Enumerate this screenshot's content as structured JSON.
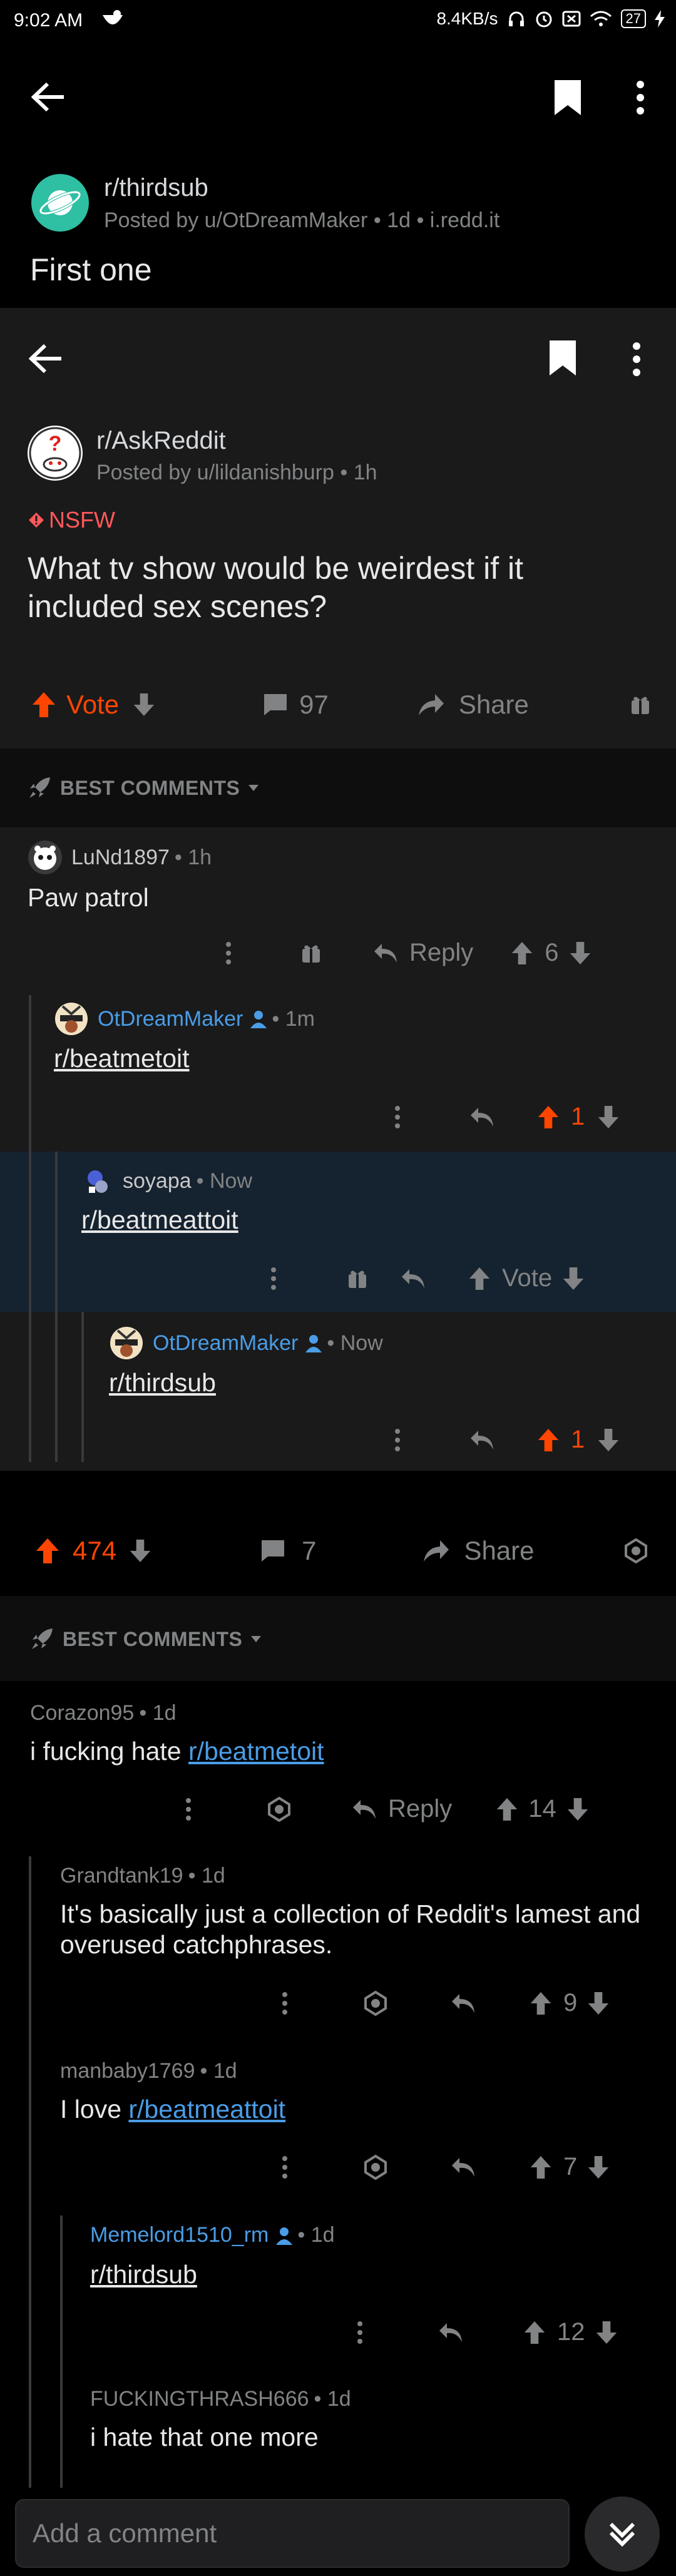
{
  "status_bar": {
    "time": "9:02 AM",
    "speed": "8.4KB/s",
    "battery": "27"
  },
  "outer_post": {
    "subreddit": "r/thirdsub",
    "byline": "Posted by u/OtDreamMaker • 1d • i.redd.it",
    "title": "First one"
  },
  "inner_post": {
    "subreddit": "r/AskReddit",
    "byline": "Posted by u/lildanishburp • 1h",
    "nsfw": "NSFW",
    "title_line1": "What tv show would be weirdest if it",
    "title_line2": "included sex scenes?",
    "vote": "Vote",
    "comments": "97",
    "share": "Share",
    "sort": "BEST COMMENTS",
    "comments_list": [
      {
        "user": "LuNd1897",
        "time": "• 1h",
        "text": "Paw patrol",
        "reply": "Reply",
        "score": "6"
      },
      {
        "user": "OtDreamMaker",
        "time": "• 1m",
        "link": "r/beatmetoit",
        "score": "1"
      },
      {
        "user": "soyapa",
        "time": "• Now",
        "link": "r/beatmeattoit",
        "vote": "Vote"
      },
      {
        "user": "OtDreamMaker",
        "time": "• Now",
        "link": "r/thirdsub",
        "score": "1"
      }
    ]
  },
  "outer_actions": {
    "score": "474",
    "comments": "7",
    "share": "Share"
  },
  "outer_sort": "BEST COMMENTS",
  "outer_comments": [
    {
      "user": "Corazon95",
      "time": "• 1d",
      "text": "i fucking hate ",
      "link": "r/beatmetoit",
      "reply": "Reply",
      "score": "14"
    },
    {
      "user": "Grandtank19",
      "time": "• 1d",
      "text_line1": "It's basically just a collection of Reddit's lamest and",
      "text_line2": "overused catchphrases.",
      "score": "9"
    },
    {
      "user": "manbaby1769",
      "time": "• 1d",
      "text": "I love ",
      "link": "r/beatmeattoit",
      "score": "7"
    },
    {
      "user": "Memelord1510_rm",
      "time": "• 1d",
      "link": "r/thirdsub",
      "score": "12"
    },
    {
      "user": "FUCKINGTHRASH666",
      "time": "• 1d",
      "text": "i hate that one more"
    }
  ],
  "comment_bar": {
    "placeholder": "Add a comment"
  },
  "colors": {
    "orange": "#ff4500",
    "link": "#4a9de6",
    "bg_dark": "#1a1a1b",
    "highlight": "#15222f"
  }
}
